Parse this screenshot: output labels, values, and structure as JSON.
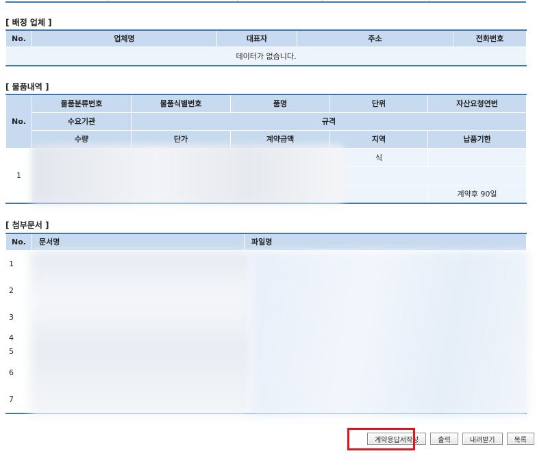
{
  "vendors": {
    "title": "[ 배정 업체 ]",
    "headers": [
      "No.",
      "업체명",
      "대표자",
      "주소",
      "전화번호"
    ],
    "empty_message": "데이터가 없습니다."
  },
  "items": {
    "title": "[ 물품내역 ]",
    "no_header": "No.",
    "header_row1": [
      "물품분류번호",
      "물품식별번호",
      "품명",
      "단위",
      "자산요청연번"
    ],
    "header_row2": [
      "수요기관",
      "규격"
    ],
    "header_row3": [
      "수량",
      "단가",
      "계약금액",
      "지역",
      "납품기한"
    ],
    "row": {
      "no": "1",
      "unit": "식",
      "deadline": "계약후 90일"
    }
  },
  "attachments": {
    "title": "[ 첨부문서 ]",
    "headers": [
      "No.",
      "문서명",
      "파일명"
    ],
    "rows": [
      "1",
      "2",
      "3",
      "4",
      "5",
      "6",
      "7"
    ]
  },
  "buttons": {
    "write_response": "계약응답서작성",
    "print": "출력",
    "download": "내려받기",
    "list": "목록"
  },
  "colors": {
    "accent": "#3b77b8",
    "header_bg": "#c7daef",
    "row_bg": "#eef4fb",
    "highlight": "#e0141e"
  }
}
